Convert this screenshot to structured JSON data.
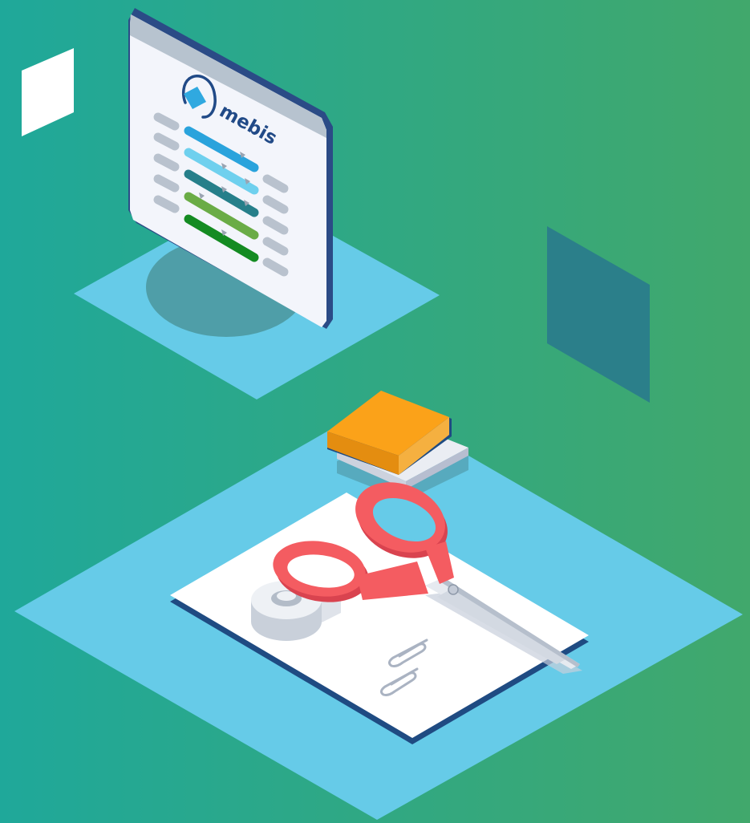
{
  "logo": {
    "text": "mebis"
  },
  "colors": {
    "background_left": "#1fa89a",
    "background_right": "#41a86c",
    "platform": "#66cbe8",
    "dark_square": "#2b7f8a",
    "monitor_frame": "#2b4b86",
    "screen": "#f3f5fb",
    "logo_blue": "#214a87",
    "logo_mark": "#30a9e0",
    "menu_bar_colors": [
      "#2aa3dc",
      "#6fd0ee",
      "#267f8a",
      "#6aac46",
      "#148b22"
    ],
    "grey_pill": "#b9c2ce",
    "sticky_note": "#fba219",
    "scissors": "#f45c61",
    "paper": "#ffffff",
    "tape": "#e8ebf0"
  },
  "icons": {
    "logo": "mebis-logo-icon",
    "scissors": "scissors-icon",
    "tape": "tape-roll-icon",
    "paperclips": "paperclip-icon",
    "sticky_notes": "sticky-notes-icon"
  }
}
